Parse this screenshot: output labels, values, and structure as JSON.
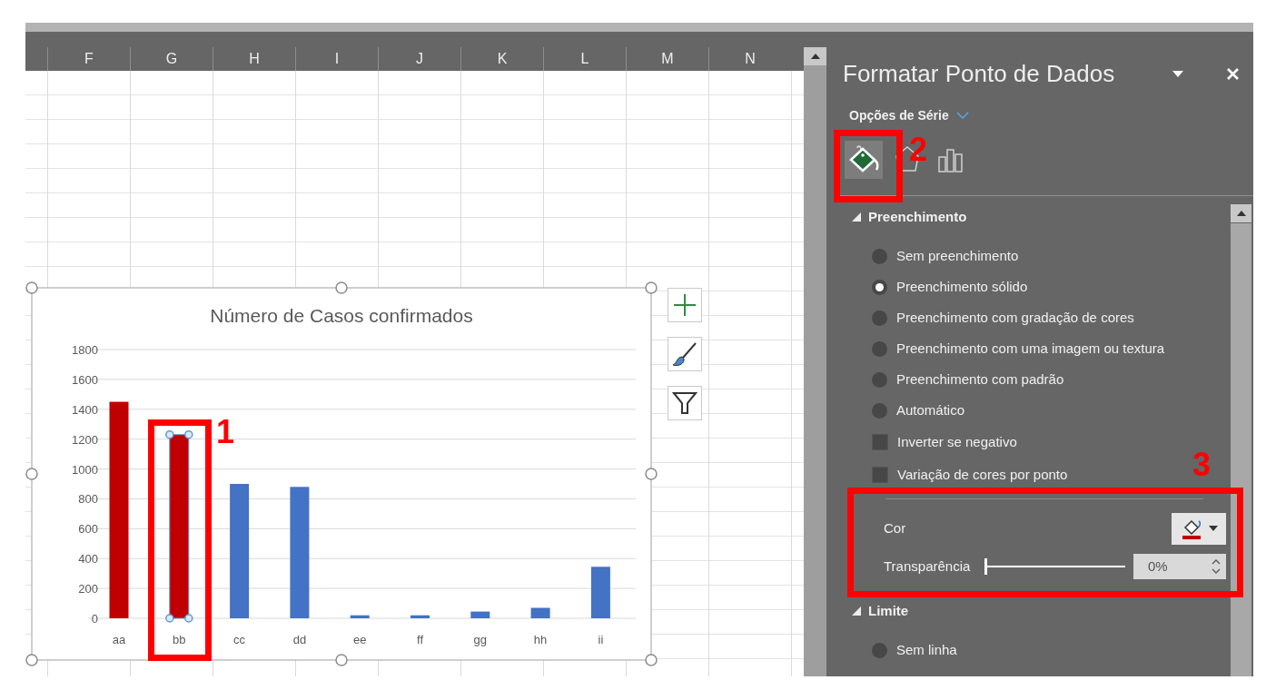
{
  "sheet": {
    "columns": [
      "F",
      "G",
      "H",
      "I",
      "J",
      "K",
      "L",
      "M",
      "N"
    ]
  },
  "chart": {
    "chart_data": {
      "type": "bar",
      "title": "Número de Casos confirmados",
      "categories": [
        "aa",
        "bb",
        "cc",
        "dd",
        "ee",
        "ff",
        "gg",
        "hh",
        "ii"
      ],
      "series": [
        {
          "values": [
            1450,
            1230,
            900,
            880,
            20,
            20,
            45,
            70,
            345
          ]
        }
      ],
      "grid": true,
      "ylim": [
        0,
        1800
      ],
      "yticks": [
        0,
        200,
        400,
        600,
        800,
        1000,
        1200,
        1400,
        1600,
        1800
      ]
    },
    "points": [
      {
        "color": "#c00000",
        "selected": false
      },
      {
        "color": "#c00000",
        "selected": true
      },
      {
        "color": "#4472c4",
        "selected": false
      },
      {
        "color": "#4472c4",
        "selected": false
      },
      {
        "color": "#4472c4",
        "selected": false
      },
      {
        "color": "#4472c4",
        "selected": false
      },
      {
        "color": "#4472c4",
        "selected": false
      },
      {
        "color": "#4472c4",
        "selected": false
      },
      {
        "color": "#4472c4",
        "selected": false
      }
    ]
  },
  "pane": {
    "title": "Formatar Ponto de Dados",
    "options_label": "Opções de Série",
    "tabs": [
      {
        "kind": "fill",
        "selected": true
      },
      {
        "kind": "effects",
        "selected": false
      },
      {
        "kind": "series",
        "selected": false
      }
    ],
    "sections": [
      {
        "title": "Preenchimento",
        "expanded": true,
        "options": [
          {
            "kind": "radio",
            "label": "Sem preenchimento",
            "selected": false
          },
          {
            "kind": "radio",
            "label": "Preenchimento sólido",
            "selected": true
          },
          {
            "kind": "radio",
            "label": "Preenchimento com gradação de cores",
            "selected": false
          },
          {
            "kind": "radio",
            "label": "Preenchimento com uma imagem ou textura",
            "selected": false
          },
          {
            "kind": "radio",
            "label": "Preenchimento com padrão",
            "selected": false
          },
          {
            "kind": "radio",
            "label": "Automático",
            "selected": false
          },
          {
            "kind": "checkbox",
            "label": "Inverter se negativo",
            "checked": false
          },
          {
            "kind": "checkbox",
            "label": "Variação de cores por ponto",
            "checked": false
          }
        ],
        "color_field": {
          "label": "Cor",
          "color": "#c00000"
        },
        "transparency": {
          "label": "Transparência",
          "level": 0,
          "reading": "0%"
        }
      },
      {
        "title": "Limite",
        "expanded": true,
        "options": [
          {
            "kind": "radio",
            "label": "Sem linha",
            "selected": false
          }
        ]
      }
    ]
  },
  "callouts": [
    {
      "label": "1"
    },
    {
      "label": "2"
    },
    {
      "label": "3"
    }
  ]
}
